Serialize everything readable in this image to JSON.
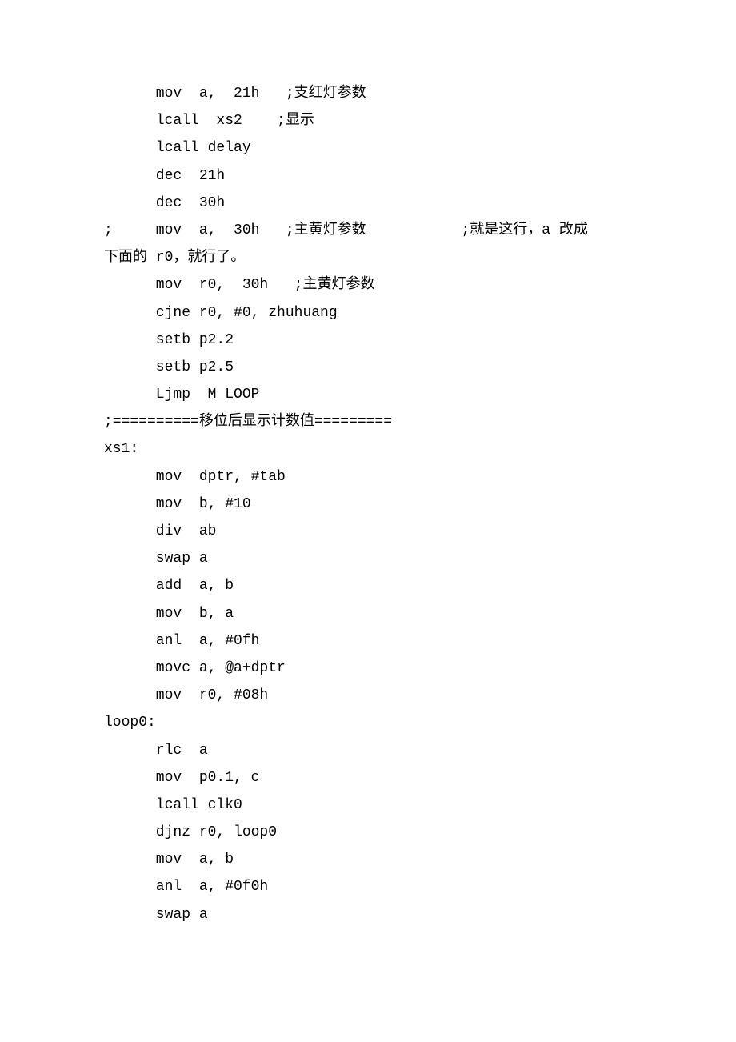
{
  "lines": [
    "      mov  a,  21h   ;支红灯参数",
    "      lcall  xs2    ;显示",
    "      lcall delay",
    "      dec  21h",
    "      dec  30h",
    ";     mov  a,  30h   ;主黄灯参数           ;就是这行，a 改成",
    "下面的 r0，就行了。",
    "      mov  r0,  30h   ;主黄灯参数",
    "      cjne r0, #0, zhuhuang",
    "      setb p2.2",
    "      setb p2.5",
    "      Ljmp  M_LOOP",
    ";==========移位后显示计数值=========",
    "xs1:",
    "      mov  dptr, #tab",
    "      mov  b, #10",
    "      div  ab",
    "      swap a",
    "      add  a, b",
    "      mov  b, a",
    "      anl  a, #0fh",
    "      movc a, @a+dptr",
    "      mov  r0, #08h",
    "loop0:",
    "      rlc  a",
    "      mov  p0.1, c",
    "      lcall clk0",
    "      djnz r0, loop0",
    "      mov  a, b",
    "      anl  a, #0f0h",
    "      swap a"
  ]
}
